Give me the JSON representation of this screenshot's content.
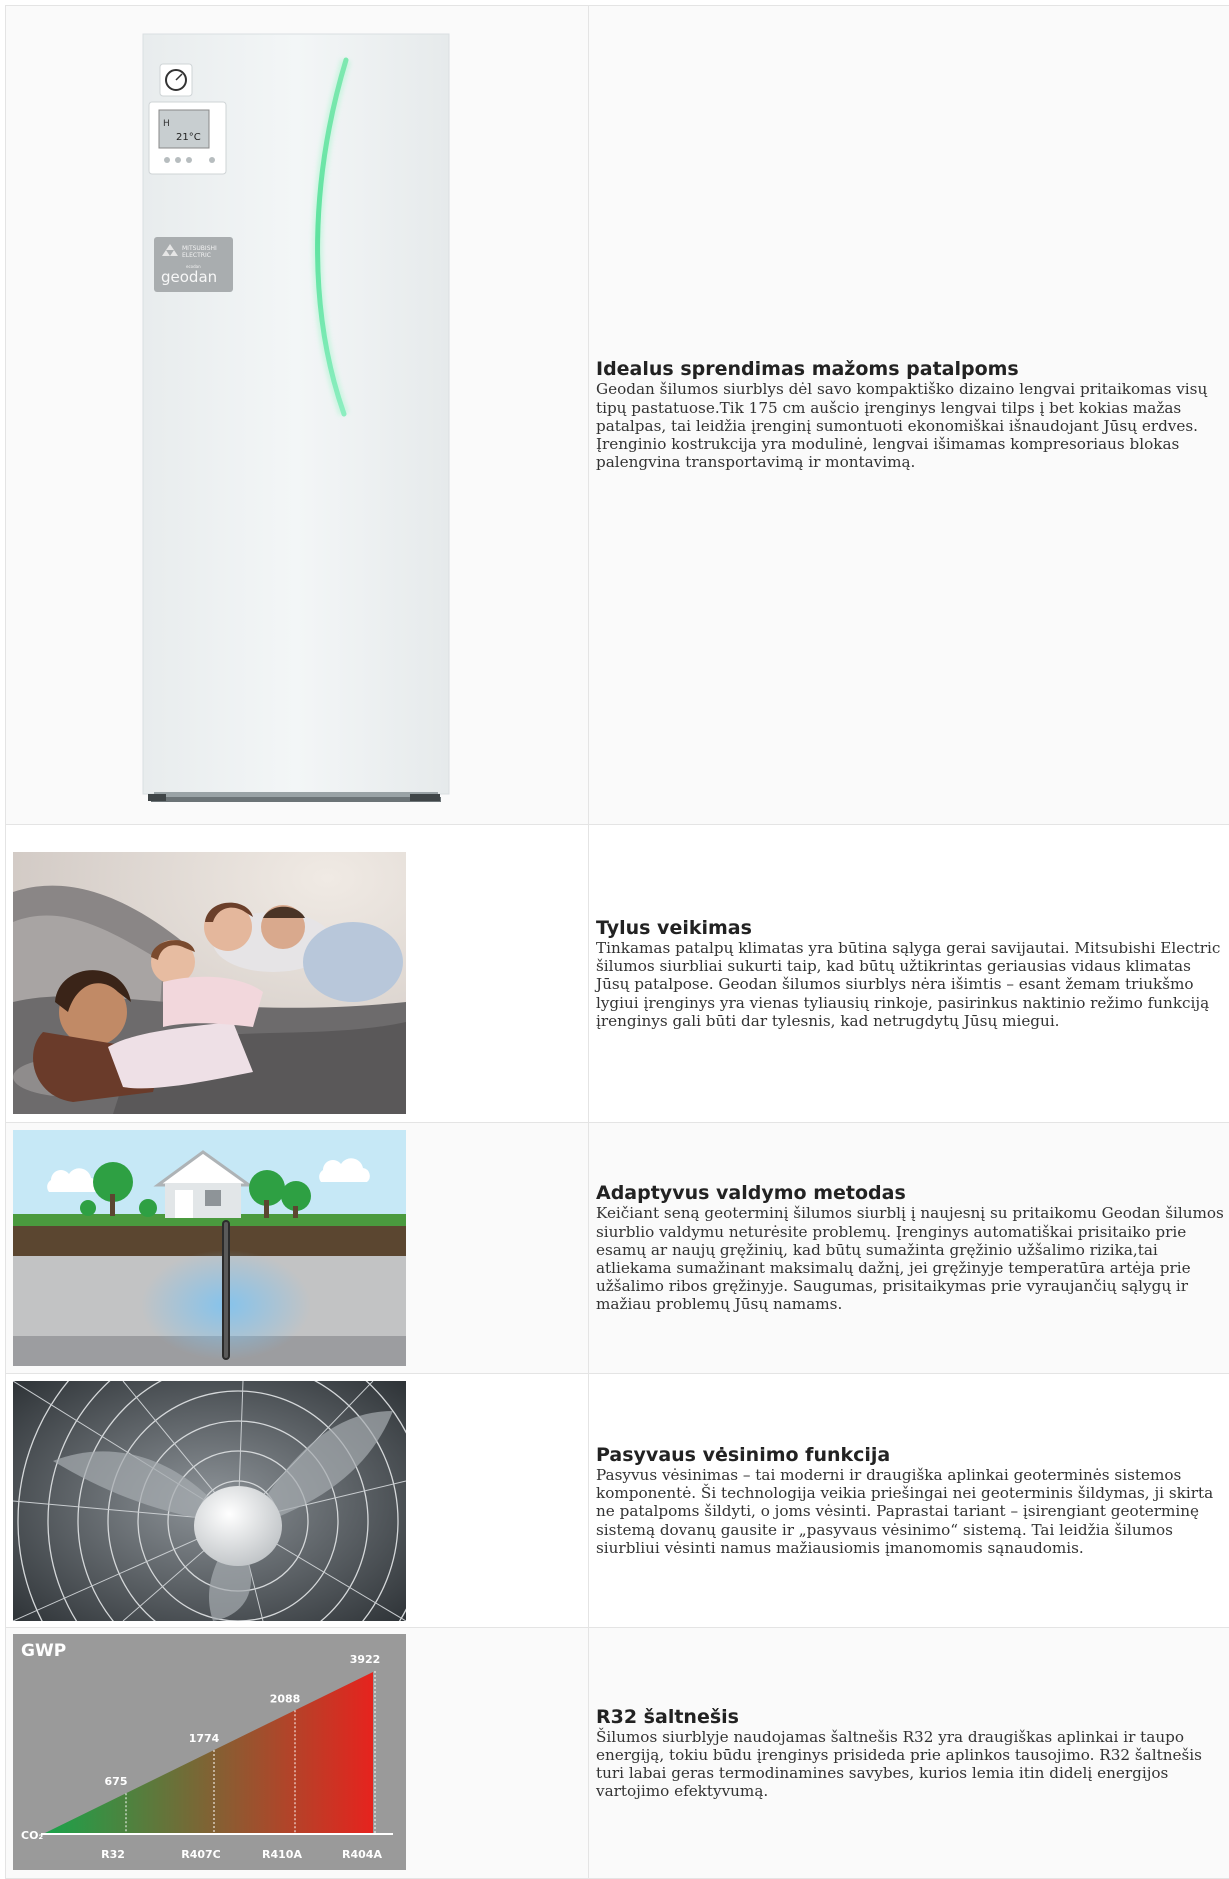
{
  "rows": [
    {
      "heading": "Idealus sprendimas mažoms patalpoms",
      "text": "Geodan šilumos siurblys dėl savo kompaktiško dizaino lengvai pritaikomas visų tipų pastatuose.Tik 175 cm aušcio įrenginys lengvai tilps į bet kokias mažas patalpas, tai leidžia įrenginį sumontuoti ekonomiškai išnaudojant Jūsų erdves. Įrenginio kostrukcija yra modulinė, lengvai išimamas kompresoriaus blokas palengvina transportavimą ir montavimą.",
      "image": {
        "brand_line1": "MITSUBISHI",
        "brand_line2": "ELECTRIC",
        "brand_sub": "ecodan",
        "brand_name": "geodan",
        "screen_line1": "H",
        "screen_line2": "21°C"
      }
    },
    {
      "heading": "Tylus veikimas",
      "text": "Tinkamas patalpų klimatas yra būtina sąlyga gerai  savijautai. Mitsubishi Electric šilumos siurbliai sukurti taip, kad būtų užtikrintas geriausias vidaus klimatas Jūsų patalpose. Geodan šilumos siurblys nėra išimtis – esant žemam triukšmo lygiui įrenginys yra vienas tyliausių rinkoje, pasirinkus naktinio režimo funkciją įrenginys gali būti dar tylesnis, kad netrugdytų Jūsų miegui."
    },
    {
      "heading": "Adaptyvus valdymo metodas",
      "text": "Keičiant seną geoterminį šilumos siurblį į naujesnį  su pritaikomu Geodan šilumos siurblio valdymu neturėsite problemų. Įrenginys automatiškai prisitaiko prie esamų ar naujų gręžinių, kad būtų sumažinta gręžinio užšalimo rizika,tai atliekama sumažinant maksimalų dažnį, jei gręžinyje temperatūra artėja prie užšalimo ribos gręžinyje. Saugumas, prisitaikymas prie vyraujančių sąlygų ir mažiau problemų Jūsų namams."
    },
    {
      "heading": "Pasyvaus vėsinimo funkcija",
      "text": "Pasyvus vėsinimas – tai moderni ir draugiška aplinkai geoterminės sistemos komponentė. Ši technologija veikia priešingai nei geoterminis šildymas, ji skirta ne patalpoms šildyti, o joms vėsinti. Paprastai tariant – įsirengiant geoterminę sistemą dovanų gausite ir „pasyvaus vėsinimo“ sistemą. Tai leidžia šilumos siurbliui vėsinti namus mažiausiomis įmanomomis sąnaudomis."
    },
    {
      "heading": "R32 šaltnešis",
      "text": "Šilumos siurblyje naudojamas šaltnešis R32 yra draugiškas aplinkai ir taupo energiją, tokiu būdu įrenginys prisideda prie aplinkos tausojimo. R32 šaltnešis turi labai geras termodinamines savybes, kurios lemia itin didelį energijos vartojimo efektyvumą."
    }
  ],
  "gwp_chart": {
    "title": "GWP",
    "origin_label": "CO₂",
    "categories": [
      "R32",
      "R407C",
      "R410A",
      "R404A"
    ],
    "values": [
      675,
      1774,
      2088,
      3922
    ],
    "colors": {
      "background": "#9a9a9a",
      "start": "#1aa34a",
      "end": "#e6231e",
      "label": "#ffffff"
    }
  }
}
